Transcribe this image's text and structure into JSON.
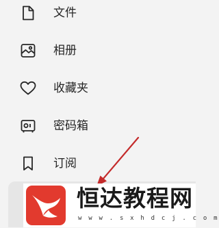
{
  "menu": {
    "items": [
      {
        "label": "文件",
        "icon": "file-icon"
      },
      {
        "label": "相册",
        "icon": "photo-album-icon"
      },
      {
        "label": "收藏夹",
        "icon": "heart-icon"
      },
      {
        "label": "密码箱",
        "icon": "vault-icon"
      },
      {
        "label": "订阅",
        "icon": "bookmark-icon"
      }
    ],
    "selected_item_label": ""
  },
  "watermark": {
    "title": "恒达教程网",
    "url": "w w w . s x h d c j . c o m",
    "logo_icon": "fox-tail-logo",
    "logo_colors": {
      "primary": "#e23a2e",
      "secondary": "#ffffff"
    }
  },
  "annotation": {
    "arrow_color": "#c42b2b",
    "arrow_icon": "red-arrow-pointer"
  },
  "colors": {
    "background": "#f3f3f3",
    "selected_background": "#e6e6e6",
    "text": "#262626"
  }
}
